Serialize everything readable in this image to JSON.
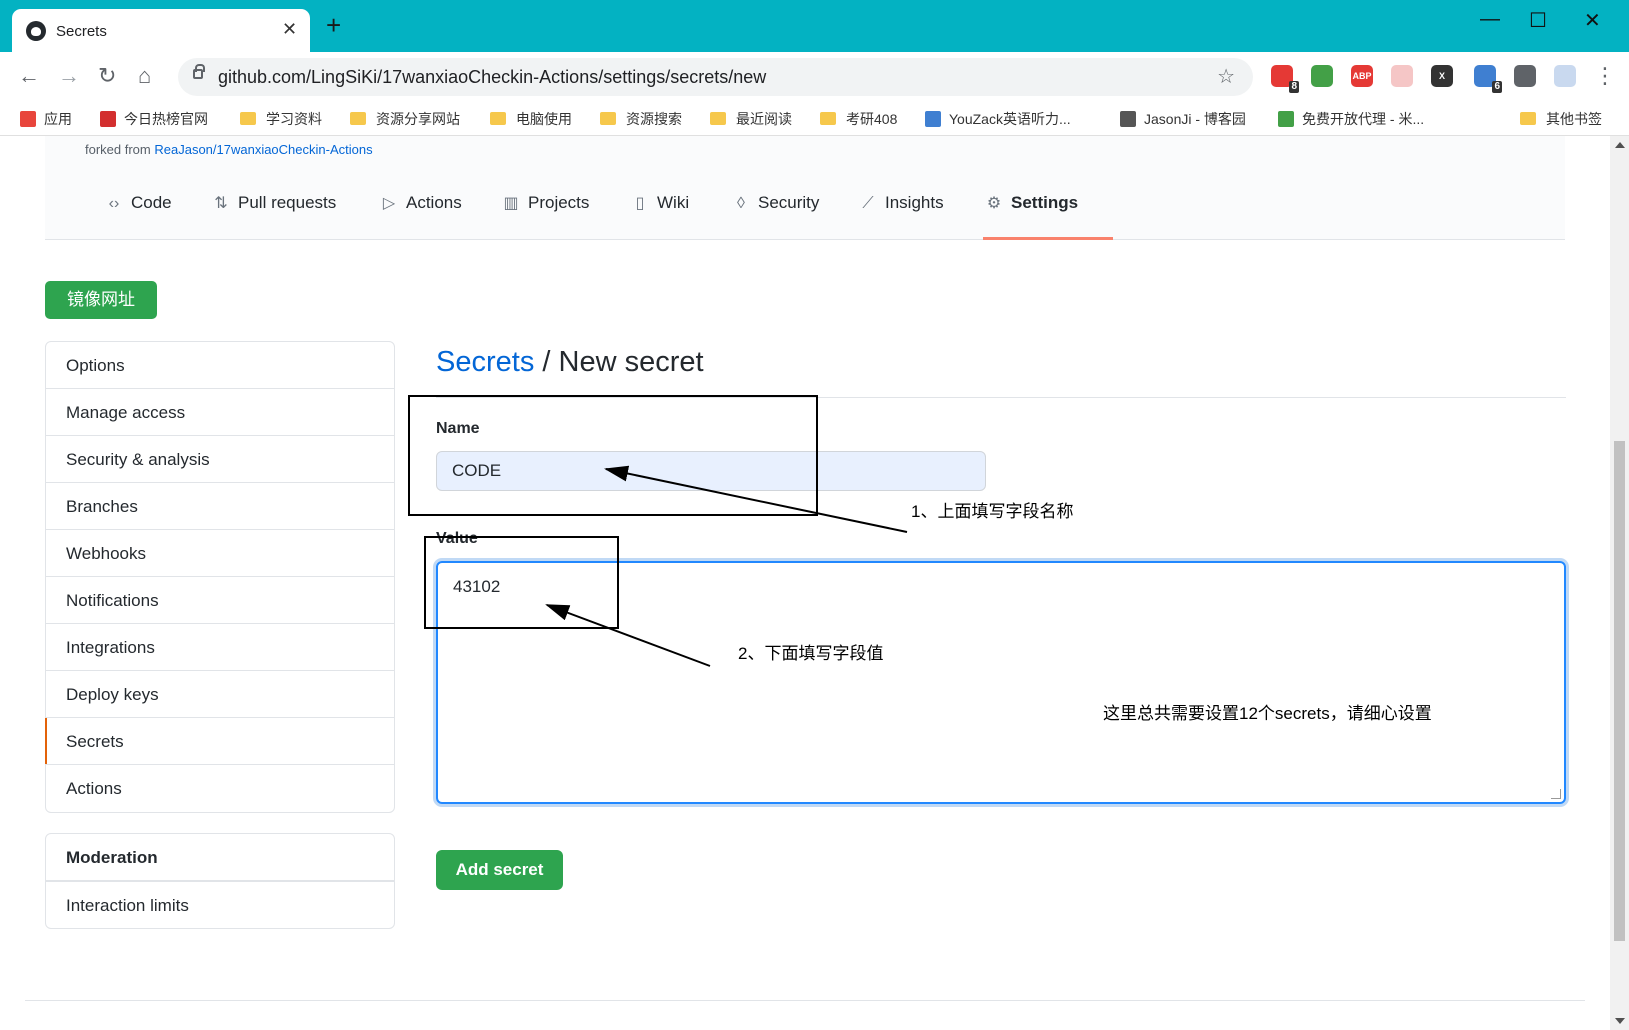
{
  "browser": {
    "tab_title": "Secrets",
    "tab_close": "✕",
    "new_tab": "+",
    "url": "github.com/LingSiKi/17wanxiaoCheckin-Actions/settings/secrets/new",
    "window_controls": {
      "minimize": "—",
      "maximize": "☐",
      "close": "✕"
    },
    "nav": {
      "back": "←",
      "forward": "→",
      "reload": "↻",
      "home": "⌂",
      "star": "☆",
      "menu": "⋮"
    },
    "extensions": [
      {
        "name": "notes-extension-icon",
        "color": "#e53935",
        "badge": "8"
      },
      {
        "name": "globe-extension-icon",
        "color": "#43a047",
        "badge": ""
      },
      {
        "name": "adblock-icon",
        "color": "#e53935",
        "text": "ABP",
        "badge": ""
      },
      {
        "name": "cat-extension-icon",
        "color": "#f5c6c6",
        "badge": ""
      },
      {
        "name": "x-extension-icon",
        "color": "#333333",
        "text": "X",
        "badge": ""
      },
      {
        "name": "apps-extension-icon",
        "color": "#3f7fd1",
        "badge": "6"
      },
      {
        "name": "puzzle-icon",
        "color": "#5f6368",
        "badge": ""
      },
      {
        "name": "profile-avatar",
        "color": "#c9d9ef",
        "badge": ""
      }
    ]
  },
  "bookmarks": [
    {
      "label": "应用",
      "icon": "apps-grid-icon"
    },
    {
      "label": "今日热榜官网",
      "icon": "r-logo-icon"
    },
    {
      "label": "学习资料",
      "icon": "folder-icon"
    },
    {
      "label": "资源分享网站",
      "icon": "folder-icon"
    },
    {
      "label": "电脑使用",
      "icon": "folder-icon"
    },
    {
      "label": "资源搜索",
      "icon": "folder-icon"
    },
    {
      "label": "最近阅读",
      "icon": "folder-icon"
    },
    {
      "label": "考研408",
      "icon": "folder-icon"
    },
    {
      "label": "YouZack英语听力...",
      "icon": "page-icon"
    },
    {
      "label": "JasonJi - 博客园",
      "icon": "blog-icon"
    },
    {
      "label": "免费开放代理 - 米...",
      "icon": "check-icon"
    },
    {
      "label": "其他书签",
      "icon": "folder-icon"
    }
  ],
  "repo": {
    "forked_prefix": "forked from ",
    "forked_link": "ReaJason/17wanxiaoCheckin-Actions",
    "tabs": [
      {
        "label": "Code",
        "icon": "‹›"
      },
      {
        "label": "Pull requests",
        "icon": "⇅"
      },
      {
        "label": "Actions",
        "icon": "▷"
      },
      {
        "label": "Projects",
        "icon": "▥"
      },
      {
        "label": "Wiki",
        "icon": "▯"
      },
      {
        "label": "Security",
        "icon": "◊"
      },
      {
        "label": "Insights",
        "icon": "⟋"
      },
      {
        "label": "Settings",
        "icon": "⚙"
      }
    ]
  },
  "mirror_button": "镜像网址",
  "sidebar": {
    "items": [
      "Options",
      "Manage access",
      "Security & analysis",
      "Branches",
      "Webhooks",
      "Notifications",
      "Integrations",
      "Deploy keys",
      "Secrets",
      "Actions"
    ],
    "selected": "Secrets",
    "moderation": {
      "heading": "Moderation",
      "items": [
        "Interaction limits"
      ]
    }
  },
  "form": {
    "breadcrumb_link": "Secrets",
    "breadcrumb_sep": " / ",
    "title": "New secret",
    "name_label": "Name",
    "name_value": "CODE",
    "value_label": "Value",
    "value_value": "43102",
    "submit": "Add secret"
  },
  "annotations": {
    "note1": "1、上面填写字段名称",
    "note2": "2、下面填写字段值",
    "note3": "这里总共需要设置12个secrets，请细心设置"
  },
  "colors": {
    "titlebar": "#03b2c2",
    "primary_green": "#2ea44f",
    "link_blue": "#0366d6",
    "selected_underline": "#f9826c"
  }
}
